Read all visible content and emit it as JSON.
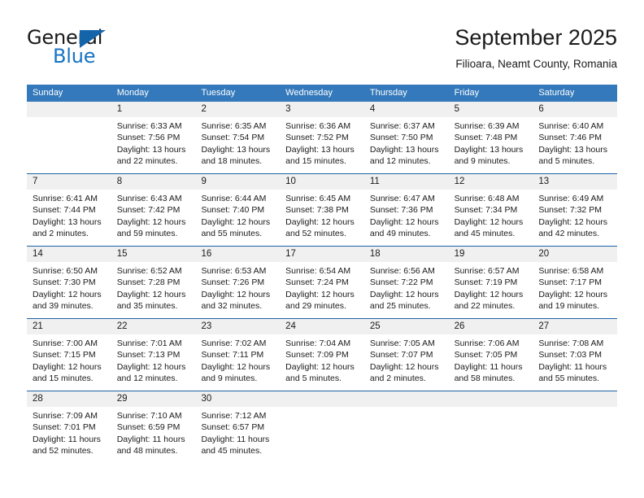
{
  "brand": {
    "name_part1": "General",
    "name_part2": "Blue",
    "triangle_color": "#1464aa",
    "blue_color": "#1773c4"
  },
  "header": {
    "title": "September 2025",
    "subtitle": "Filioara, Neamt County, Romania"
  },
  "theme": {
    "header_bg": "#3479bb",
    "header_text": "#ffffff",
    "row_divider": "#1c63a6",
    "date_band_bg": "#f0f0f0",
    "cell_bg": "#ffffff",
    "text": "#1a1a1a"
  },
  "weekdays": [
    "Sunday",
    "Monday",
    "Tuesday",
    "Wednesday",
    "Thursday",
    "Friday",
    "Saturday"
  ],
  "weeks": [
    {
      "days": [
        {
          "num": "",
          "lines": [
            "",
            "",
            "",
            ""
          ]
        },
        {
          "num": "1",
          "lines": [
            "Sunrise: 6:33 AM",
            "Sunset: 7:56 PM",
            "Daylight: 13 hours",
            "and 22 minutes."
          ]
        },
        {
          "num": "2",
          "lines": [
            "Sunrise: 6:35 AM",
            "Sunset: 7:54 PM",
            "Daylight: 13 hours",
            "and 18 minutes."
          ]
        },
        {
          "num": "3",
          "lines": [
            "Sunrise: 6:36 AM",
            "Sunset: 7:52 PM",
            "Daylight: 13 hours",
            "and 15 minutes."
          ]
        },
        {
          "num": "4",
          "lines": [
            "Sunrise: 6:37 AM",
            "Sunset: 7:50 PM",
            "Daylight: 13 hours",
            "and 12 minutes."
          ]
        },
        {
          "num": "5",
          "lines": [
            "Sunrise: 6:39 AM",
            "Sunset: 7:48 PM",
            "Daylight: 13 hours",
            "and 9 minutes."
          ]
        },
        {
          "num": "6",
          "lines": [
            "Sunrise: 6:40 AM",
            "Sunset: 7:46 PM",
            "Daylight: 13 hours",
            "and 5 minutes."
          ]
        }
      ]
    },
    {
      "days": [
        {
          "num": "7",
          "lines": [
            "Sunrise: 6:41 AM",
            "Sunset: 7:44 PM",
            "Daylight: 13 hours",
            "and 2 minutes."
          ]
        },
        {
          "num": "8",
          "lines": [
            "Sunrise: 6:43 AM",
            "Sunset: 7:42 PM",
            "Daylight: 12 hours",
            "and 59 minutes."
          ]
        },
        {
          "num": "9",
          "lines": [
            "Sunrise: 6:44 AM",
            "Sunset: 7:40 PM",
            "Daylight: 12 hours",
            "and 55 minutes."
          ]
        },
        {
          "num": "10",
          "lines": [
            "Sunrise: 6:45 AM",
            "Sunset: 7:38 PM",
            "Daylight: 12 hours",
            "and 52 minutes."
          ]
        },
        {
          "num": "11",
          "lines": [
            "Sunrise: 6:47 AM",
            "Sunset: 7:36 PM",
            "Daylight: 12 hours",
            "and 49 minutes."
          ]
        },
        {
          "num": "12",
          "lines": [
            "Sunrise: 6:48 AM",
            "Sunset: 7:34 PM",
            "Daylight: 12 hours",
            "and 45 minutes."
          ]
        },
        {
          "num": "13",
          "lines": [
            "Sunrise: 6:49 AM",
            "Sunset: 7:32 PM",
            "Daylight: 12 hours",
            "and 42 minutes."
          ]
        }
      ]
    },
    {
      "days": [
        {
          "num": "14",
          "lines": [
            "Sunrise: 6:50 AM",
            "Sunset: 7:30 PM",
            "Daylight: 12 hours",
            "and 39 minutes."
          ]
        },
        {
          "num": "15",
          "lines": [
            "Sunrise: 6:52 AM",
            "Sunset: 7:28 PM",
            "Daylight: 12 hours",
            "and 35 minutes."
          ]
        },
        {
          "num": "16",
          "lines": [
            "Sunrise: 6:53 AM",
            "Sunset: 7:26 PM",
            "Daylight: 12 hours",
            "and 32 minutes."
          ]
        },
        {
          "num": "17",
          "lines": [
            "Sunrise: 6:54 AM",
            "Sunset: 7:24 PM",
            "Daylight: 12 hours",
            "and 29 minutes."
          ]
        },
        {
          "num": "18",
          "lines": [
            "Sunrise: 6:56 AM",
            "Sunset: 7:22 PM",
            "Daylight: 12 hours",
            "and 25 minutes."
          ]
        },
        {
          "num": "19",
          "lines": [
            "Sunrise: 6:57 AM",
            "Sunset: 7:19 PM",
            "Daylight: 12 hours",
            "and 22 minutes."
          ]
        },
        {
          "num": "20",
          "lines": [
            "Sunrise: 6:58 AM",
            "Sunset: 7:17 PM",
            "Daylight: 12 hours",
            "and 19 minutes."
          ]
        }
      ]
    },
    {
      "days": [
        {
          "num": "21",
          "lines": [
            "Sunrise: 7:00 AM",
            "Sunset: 7:15 PM",
            "Daylight: 12 hours",
            "and 15 minutes."
          ]
        },
        {
          "num": "22",
          "lines": [
            "Sunrise: 7:01 AM",
            "Sunset: 7:13 PM",
            "Daylight: 12 hours",
            "and 12 minutes."
          ]
        },
        {
          "num": "23",
          "lines": [
            "Sunrise: 7:02 AM",
            "Sunset: 7:11 PM",
            "Daylight: 12 hours",
            "and 9 minutes."
          ]
        },
        {
          "num": "24",
          "lines": [
            "Sunrise: 7:04 AM",
            "Sunset: 7:09 PM",
            "Daylight: 12 hours",
            "and 5 minutes."
          ]
        },
        {
          "num": "25",
          "lines": [
            "Sunrise: 7:05 AM",
            "Sunset: 7:07 PM",
            "Daylight: 12 hours",
            "and 2 minutes."
          ]
        },
        {
          "num": "26",
          "lines": [
            "Sunrise: 7:06 AM",
            "Sunset: 7:05 PM",
            "Daylight: 11 hours",
            "and 58 minutes."
          ]
        },
        {
          "num": "27",
          "lines": [
            "Sunrise: 7:08 AM",
            "Sunset: 7:03 PM",
            "Daylight: 11 hours",
            "and 55 minutes."
          ]
        }
      ]
    },
    {
      "days": [
        {
          "num": "28",
          "lines": [
            "Sunrise: 7:09 AM",
            "Sunset: 7:01 PM",
            "Daylight: 11 hours",
            "and 52 minutes."
          ]
        },
        {
          "num": "29",
          "lines": [
            "Sunrise: 7:10 AM",
            "Sunset: 6:59 PM",
            "Daylight: 11 hours",
            "and 48 minutes."
          ]
        },
        {
          "num": "30",
          "lines": [
            "Sunrise: 7:12 AM",
            "Sunset: 6:57 PM",
            "Daylight: 11 hours",
            "and 45 minutes."
          ]
        },
        {
          "num": "",
          "lines": [
            "",
            "",
            "",
            ""
          ]
        },
        {
          "num": "",
          "lines": [
            "",
            "",
            "",
            ""
          ]
        },
        {
          "num": "",
          "lines": [
            "",
            "",
            "",
            ""
          ]
        },
        {
          "num": "",
          "lines": [
            "",
            "",
            "",
            ""
          ]
        }
      ]
    }
  ]
}
